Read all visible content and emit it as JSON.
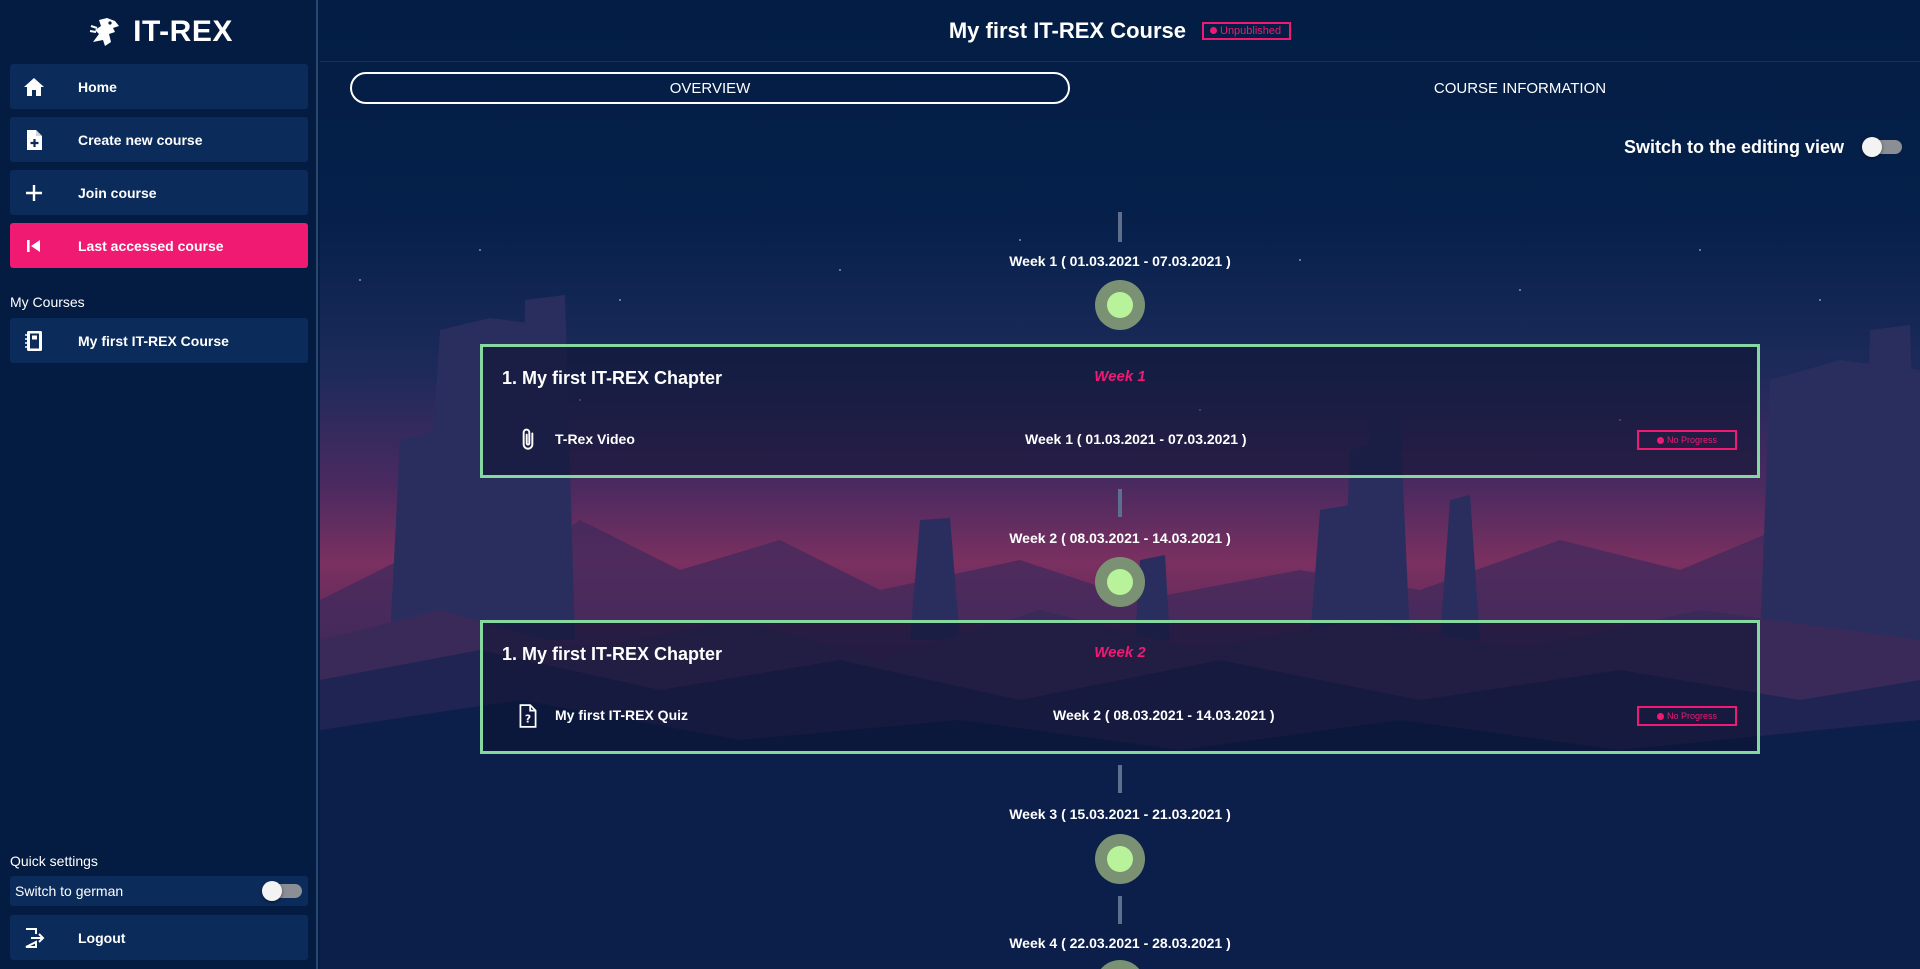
{
  "app": {
    "name": "IT-REX"
  },
  "sidebar": {
    "nav": [
      {
        "label": "Home",
        "icon": "home-icon"
      },
      {
        "label": "Create new course",
        "icon": "file-plus-icon"
      },
      {
        "label": "Join course",
        "icon": "plus-icon"
      },
      {
        "label": "Last accessed course",
        "icon": "skip-back-icon",
        "active": true
      }
    ],
    "my_courses_label": "My Courses",
    "courses": [
      {
        "label": "My first IT-REX Course",
        "icon": "notebook-icon"
      }
    ],
    "quick_settings_label": "Quick settings",
    "switch_language_label": "Switch to german",
    "switch_language_on": false,
    "logout_label": "Logout"
  },
  "course": {
    "title": "My first IT-REX Course",
    "status_badge": "Unpublished",
    "tabs": [
      {
        "label": "OVERVIEW",
        "active": true
      },
      {
        "label": "COURSE INFORMATION",
        "active": false
      }
    ],
    "edit_switch_label": "Switch to the editing view",
    "edit_switch_on": false
  },
  "timeline": {
    "weeks": [
      "Week 1 ( 01.03.2021 - 07.03.2021 )",
      "Week 2 ( 08.03.2021 - 14.03.2021 )",
      "Week 3 ( 15.03.2021 - 21.03.2021 )",
      "Week 4 ( 22.03.2021 - 28.03.2021 )"
    ],
    "chapters": [
      {
        "title": "1. My first IT-REX Chapter",
        "week": "Week 1",
        "content": {
          "icon": "paperclip-icon",
          "title": "T-Rex Video",
          "date": "Week 1 ( 01.03.2021 - 07.03.2021 )",
          "progress": "No Progress"
        }
      },
      {
        "title": "1. My first IT-REX Chapter",
        "week": "Week 2",
        "content": {
          "icon": "quiz-file-icon",
          "title": "My first IT-REX Quiz",
          "date": "Week 2 ( 08.03.2021 - 14.03.2021 )",
          "progress": "No Progress"
        }
      }
    ]
  },
  "colors": {
    "background": "#031d44",
    "accent": "#f01a73",
    "chapter_border": "#87d7a0",
    "node_inner": "#b8f29a",
    "node_outer": "#7a9273"
  }
}
